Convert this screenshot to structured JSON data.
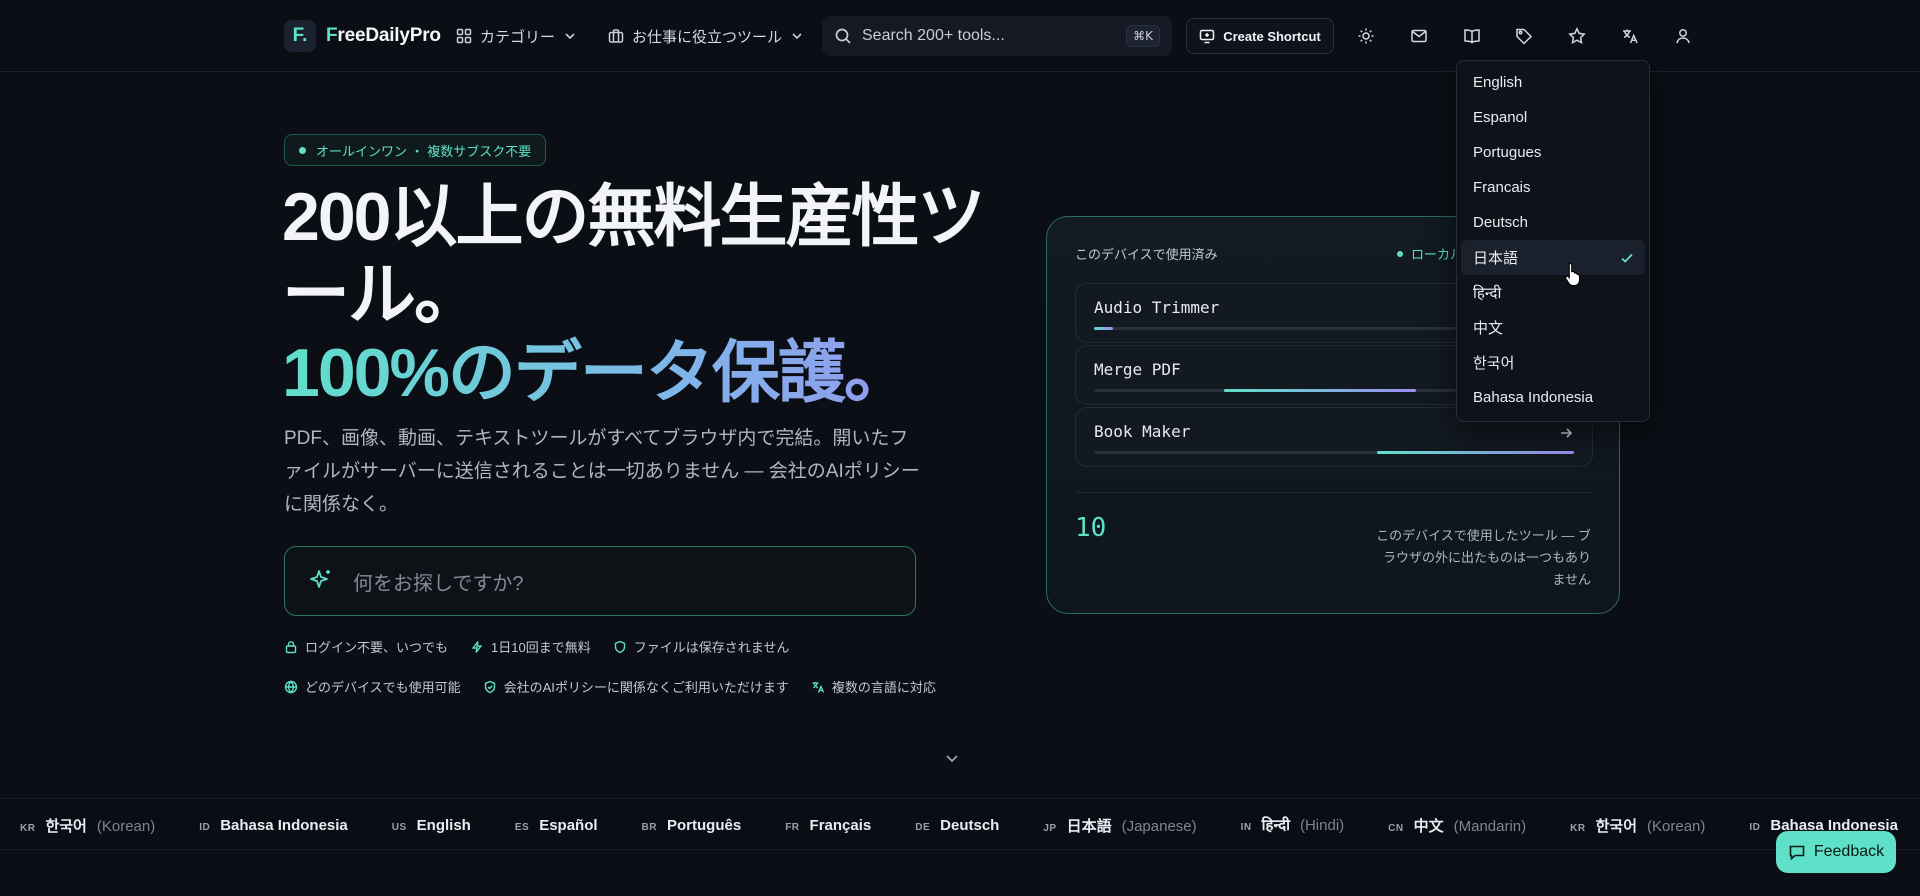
{
  "header": {
    "logo_mark": "F.",
    "logo_name_first": "F",
    "logo_name_rest": "reeDailyPro",
    "categories_label": "カテゴリー",
    "work_tools_label": "お仕事に役立つツール",
    "search_placeholder": "Search 200+ tools...",
    "search_shortcut": "⌘K",
    "create_shortcut_label": "Create Shortcut",
    "icons": [
      "sun-icon",
      "mail-icon",
      "book-icon",
      "tag-icon",
      "star-icon",
      "translate-icon",
      "user-icon"
    ]
  },
  "hero": {
    "badge": "オールインワン ・ 複数サブスク不要",
    "title_line1": "200以上の無料生産性ツ",
    "title_line2": "ール。",
    "title_line3": "100%のデータ保護。",
    "description": "PDF、画像、動画、テキストツールがすべてブラウザ内で完結。開いたファイルがサーバーに送信されることは一切ありません — 会社のAIポリシーに関係なく。",
    "search_placeholder": "何をお探しですか?",
    "features_row1": [
      {
        "icon": "lock-icon",
        "label": "ログイン不要、いつでも"
      },
      {
        "icon": "bolt-icon",
        "label": "1日10回まで無料"
      },
      {
        "icon": "shield-icon",
        "label": "ファイルは保存されません"
      }
    ],
    "features_row2": [
      {
        "icon": "globe-icon",
        "label": "どのデバイスでも使用可能"
      },
      {
        "icon": "shield-check-icon",
        "label": "会社のAIポリシーに関係なくご利用いただけます"
      },
      {
        "icon": "translate-icon",
        "label": "複数の言語に対応"
      }
    ]
  },
  "card": {
    "label": "このデバイスで使用済み",
    "local_label": "ローカル",
    "tools": [
      {
        "name": "Audio Trimmer",
        "progress_start": 0.0,
        "progress_end": 0.04
      },
      {
        "name": "Merge PDF",
        "progress_start": 0.27,
        "progress_end": 0.67
      },
      {
        "name": "Book Maker",
        "progress_start": 0.59,
        "progress_end": 1.0
      }
    ],
    "count": "10",
    "note": "このデバイスで使用したツール — ブラウザの外に出たものは一つもありません"
  },
  "language_menu": {
    "items": [
      "English",
      "Espanol",
      "Portugues",
      "Francais",
      "Deutsch",
      "日本語",
      "हिन्दी",
      "中文",
      "한국어",
      "Bahasa Indonesia"
    ],
    "selected": "日本語"
  },
  "marquee": [
    {
      "code": "KR",
      "name": "한국어",
      "sub": "(Korean)"
    },
    {
      "code": "ID",
      "name": "Bahasa Indonesia",
      "sub": ""
    },
    {
      "code": "US",
      "name": "English",
      "sub": ""
    },
    {
      "code": "ES",
      "name": "Español",
      "sub": ""
    },
    {
      "code": "BR",
      "name": "Português",
      "sub": ""
    },
    {
      "code": "FR",
      "name": "Français",
      "sub": ""
    },
    {
      "code": "DE",
      "name": "Deutsch",
      "sub": ""
    },
    {
      "code": "JP",
      "name": "日本語",
      "sub": "(Japanese)"
    },
    {
      "code": "IN",
      "name": "हिन्दी",
      "sub": "(Hindi)"
    },
    {
      "code": "CN",
      "name": "中文",
      "sub": "(Mandarin)"
    },
    {
      "code": "KR",
      "name": "한국어",
      "sub": "(Korean)"
    },
    {
      "code": "ID",
      "name": "Bahasa Indonesia",
      "sub": ""
    }
  ],
  "feedback_label": "Feedback",
  "colors": {
    "accent": "#5fe0c8",
    "accent_purple": "#9a8cf0",
    "background": "#0b0e15"
  }
}
